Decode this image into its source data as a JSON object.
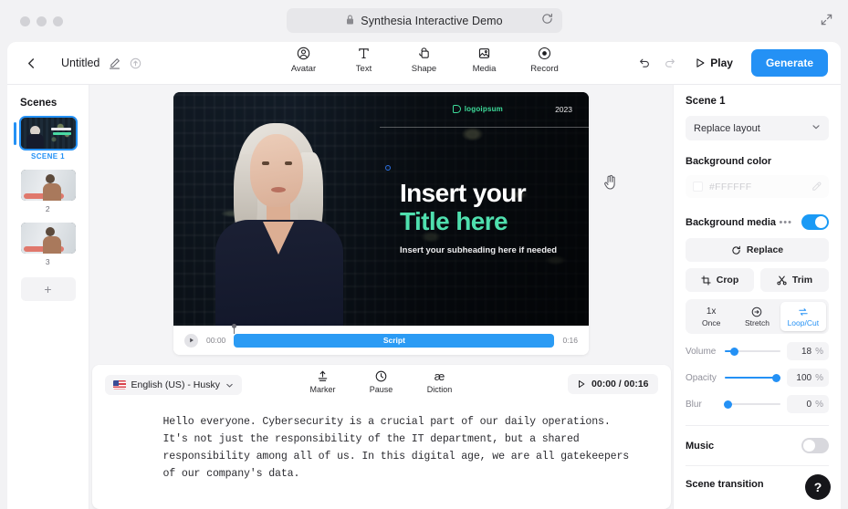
{
  "browser": {
    "url_title": "Synthesia Interactive Demo",
    "lock_icon": "lock-icon",
    "reload_icon": "reload-icon",
    "expand_icon": "expand-icon"
  },
  "header": {
    "back_icon": "chevron-left-icon",
    "doc_title": "Untitled",
    "edit_icon": "pencil-icon",
    "upload_icon": "upload-cloud-icon",
    "tools": [
      {
        "label": "Avatar",
        "icon": "avatar-icon"
      },
      {
        "label": "Text",
        "icon": "text-icon"
      },
      {
        "label": "Shape",
        "icon": "shape-icon"
      },
      {
        "label": "Media",
        "icon": "media-icon"
      },
      {
        "label": "Record",
        "icon": "record-icon"
      }
    ],
    "undo_icon": "undo-icon",
    "redo_icon": "redo-icon",
    "play_label": "Play",
    "generate_label": "Generate",
    "generate_color": "#2491f5"
  },
  "scenes": {
    "title": "Scenes",
    "items": [
      {
        "label": "SCENE 1",
        "selected": true
      },
      {
        "label": "2",
        "selected": false
      },
      {
        "label": "3",
        "selected": false
      }
    ],
    "add_label": "+"
  },
  "canvas": {
    "logo_text": "logoipsum",
    "year": "2023",
    "title_line1": "Insert your",
    "title_line2": "Title here",
    "subheading": "Insert your subheading here if needed",
    "accent_color": "#4fdfae",
    "cursor_icon": "hand-cursor-icon"
  },
  "timeline": {
    "play_icon": "play-icon",
    "start_time": "00:00",
    "track_label": "Script",
    "end_time": "0:16",
    "track_color": "#2b9bf4"
  },
  "script": {
    "language": "English (US) - Husky",
    "flag_icon": "us-flag-icon",
    "chevron_icon": "chevron-down-icon",
    "tools": [
      {
        "label": "Marker",
        "icon": "marker-icon"
      },
      {
        "label": "Pause",
        "icon": "clock-icon"
      },
      {
        "label": "Diction",
        "icon": "diction-icon"
      }
    ],
    "time_display": "00:00 / 00:16",
    "play_icon": "play-icon",
    "body": "Hello everyone. Cybersecurity is a crucial part of our daily operations. It's not just the responsibility of the IT department, but a shared responsibility among all of us. In this digital age, we are all gatekeepers of our company's data."
  },
  "settings": {
    "scene_title": "Scene 1",
    "layout_select": "Replace layout",
    "background_color_label": "Background color",
    "background_color_value": "#FFFFFF",
    "eyedropper_icon": "eyedropper-icon",
    "background_media_label": "Background media",
    "background_media_menu": "•••",
    "background_media_on": true,
    "replace_label": "Replace",
    "replace_icon": "refresh-icon",
    "crop_label": "Crop",
    "crop_icon": "crop-icon",
    "trim_label": "Trim",
    "trim_icon": "scissors-icon",
    "fit_modes": [
      {
        "top": "1x",
        "label": "Once",
        "active": false
      },
      {
        "top": "stretch-icon",
        "label": "Stretch",
        "active": false
      },
      {
        "top": "loop-icon",
        "label": "Loop/Cut",
        "active": true
      }
    ],
    "sliders": [
      {
        "name": "Volume",
        "value": "18",
        "unit": "%",
        "percent": 18
      },
      {
        "name": "Opacity",
        "value": "100",
        "unit": "%",
        "percent": 100
      },
      {
        "name": "Blur",
        "value": "0",
        "unit": "%",
        "percent": 0
      }
    ],
    "music_label": "Music",
    "music_on": false,
    "scene_transition_label": "Scene transition",
    "help_label": "?"
  }
}
